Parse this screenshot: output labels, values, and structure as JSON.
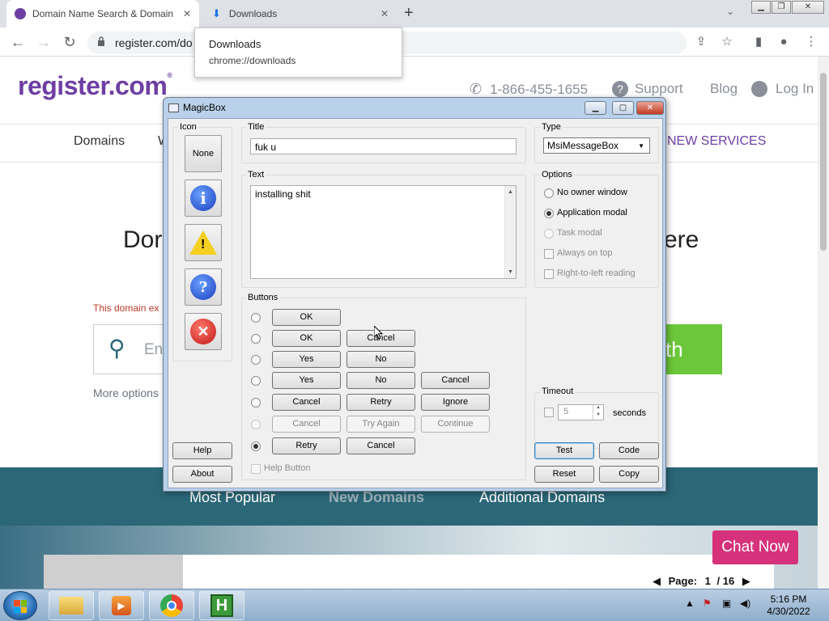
{
  "browser": {
    "tabs": [
      {
        "title": "Domain Name Search & Domain",
        "active": true
      },
      {
        "title": "Downloads",
        "active": false
      }
    ],
    "url": "register.com/do",
    "downloads_popup": {
      "title": "Downloads",
      "path": "chrome://downloads"
    }
  },
  "site": {
    "logo": "register.com",
    "logo_mark": "®",
    "phone": "1-866-455-1655",
    "support": "Support",
    "blog": "Blog",
    "login": "Log In",
    "nav": {
      "domains": "Domains",
      "w": "W",
      "new_services": "NEW SERVICES"
    },
    "hero_left": "Dor",
    "hero_right": "ere",
    "error": "This domain ex",
    "search_placeholder": "Ent",
    "search_button": "th",
    "more_options": "More options",
    "band": {
      "popular": "Most Popular",
      "new": "New Domains",
      "additional": "Additional Domains"
    },
    "chat": "Chat Now",
    "pager": {
      "label": "Page:",
      "current": "1",
      "total": "/ 16"
    }
  },
  "dialog": {
    "title": "MagicBox",
    "icon_group": "Icon",
    "icon_none": "None",
    "title_group": "Title",
    "title_value": "fuk u",
    "text_group": "Text",
    "text_value": "installing shit",
    "type_group": "Type",
    "type_value": "MsiMessageBox",
    "options_group": "Options",
    "options": [
      {
        "label": "No owner window",
        "selected": false,
        "disabled": false
      },
      {
        "label": "Application modal",
        "selected": true,
        "disabled": false
      },
      {
        "label": "Task modal",
        "selected": false,
        "disabled": true
      }
    ],
    "checks": [
      {
        "label": "Always on top",
        "disabled": true
      },
      {
        "label": "Right-to-left reading",
        "disabled": true
      }
    ],
    "buttons_group": "Buttons",
    "button_rows": [
      {
        "buttons": [
          "OK"
        ],
        "selected": false,
        "disabled": false
      },
      {
        "buttons": [
          "OK",
          "Cancel"
        ],
        "selected": false,
        "disabled": false
      },
      {
        "buttons": [
          "Yes",
          "No"
        ],
        "selected": false,
        "disabled": false
      },
      {
        "buttons": [
          "Yes",
          "No",
          "Cancel"
        ],
        "selected": false,
        "disabled": false
      },
      {
        "buttons": [
          "Cancel",
          "Retry",
          "Ignore"
        ],
        "selected": false,
        "disabled": false
      },
      {
        "buttons": [
          "Cancel",
          "Try Again",
          "Continue"
        ],
        "selected": false,
        "disabled": true
      },
      {
        "buttons": [
          "Retry",
          "Cancel"
        ],
        "selected": true,
        "disabled": false
      }
    ],
    "help_button_check": "Help Button",
    "timeout_group": "Timeout",
    "timeout_value": "5",
    "timeout_unit": "seconds",
    "help": "Help",
    "about": "About",
    "test": "Test",
    "code": "Code",
    "reset": "Reset",
    "copy": "Copy"
  },
  "taskbar": {
    "time": "5:16 PM",
    "date": "4/30/2022"
  }
}
